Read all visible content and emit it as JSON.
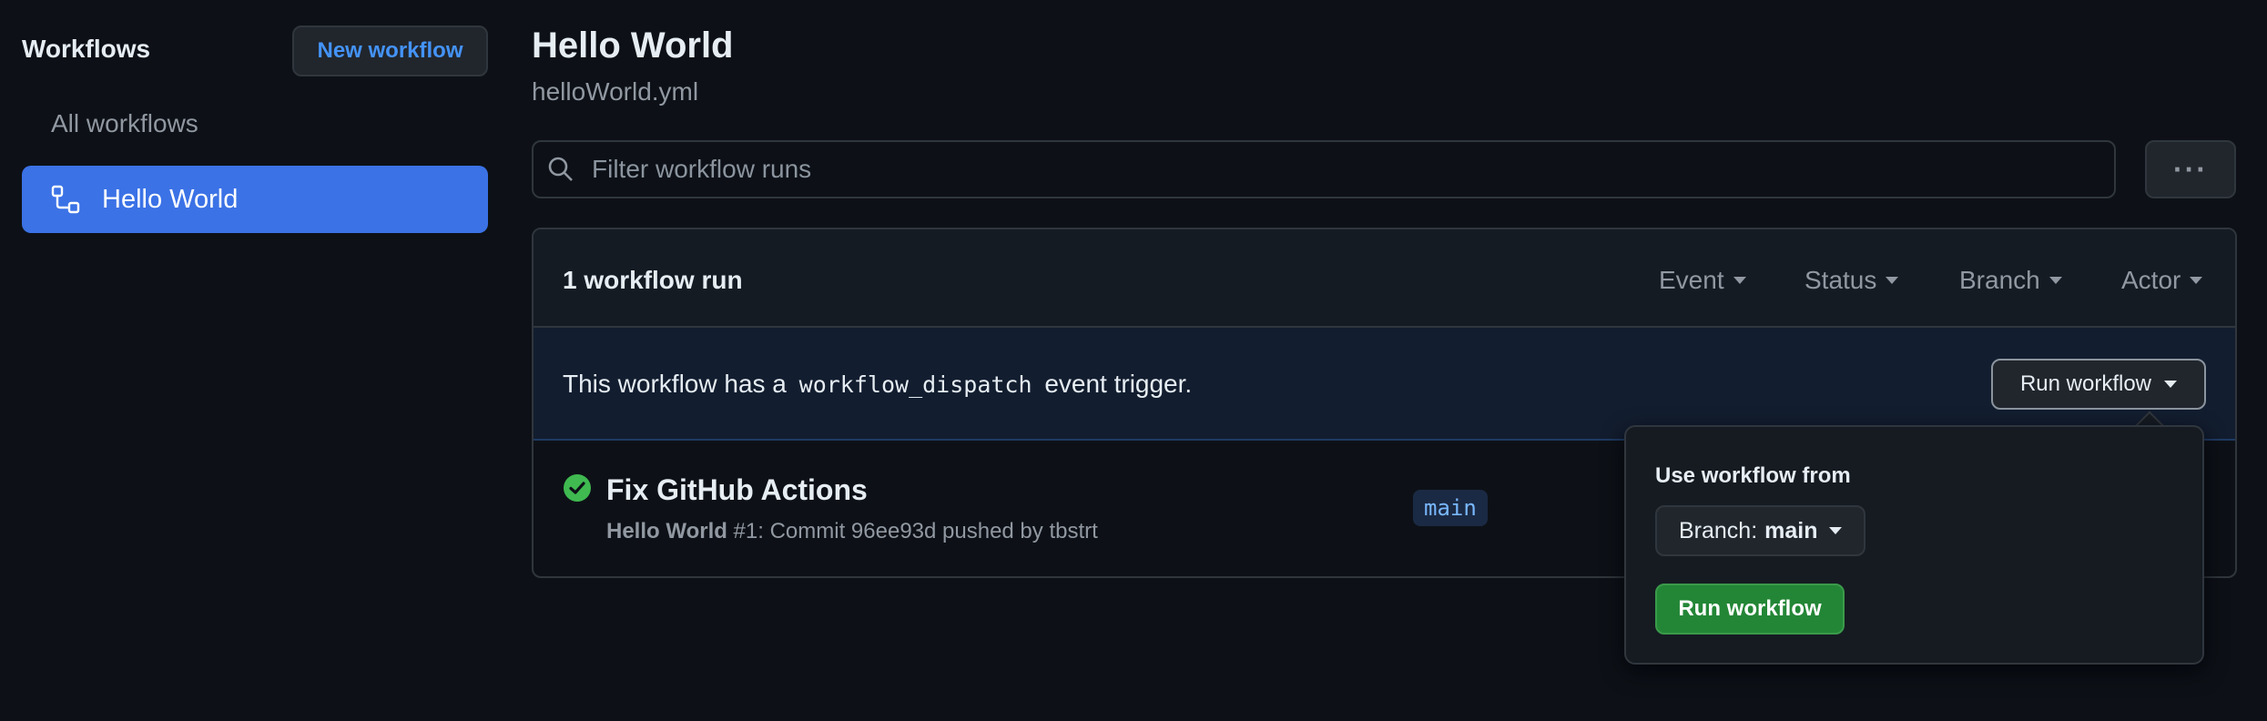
{
  "sidebar": {
    "title": "Workflows",
    "new_workflow_label": "New workflow",
    "items": [
      {
        "label": "All workflows",
        "selected": false
      },
      {
        "label": "Hello World",
        "selected": true,
        "icon": "workflow-icon"
      }
    ]
  },
  "header": {
    "title": "Hello World",
    "subtitle": "helloWorld.yml"
  },
  "search": {
    "placeholder": "Filter workflow runs",
    "value": ""
  },
  "more_menu": {
    "label": "···",
    "icon": "kebab-horizontal-icon"
  },
  "runs": {
    "count_label": "1 workflow run",
    "filters": [
      "Event",
      "Status",
      "Branch",
      "Actor"
    ],
    "dispatch_banner": {
      "text_before": "This workflow has a",
      "code": "workflow_dispatch",
      "text_after": "event trigger.",
      "button_label": "Run workflow"
    },
    "items": [
      {
        "title": "Fix GitHub Actions",
        "status": "success",
        "workflow_name": "Hello World",
        "meta_rest": " #1: Commit 96ee93d pushed by tbstrt",
        "branch": "main"
      }
    ]
  },
  "popover": {
    "title": "Use workflow from",
    "branch_prefix": "Branch:",
    "branch_name": "main",
    "run_button_label": "Run workflow"
  },
  "colors": {
    "background": "#0d1117",
    "accent": "#3b72e6",
    "success": "#3fb950",
    "primary_button": "#238636"
  }
}
